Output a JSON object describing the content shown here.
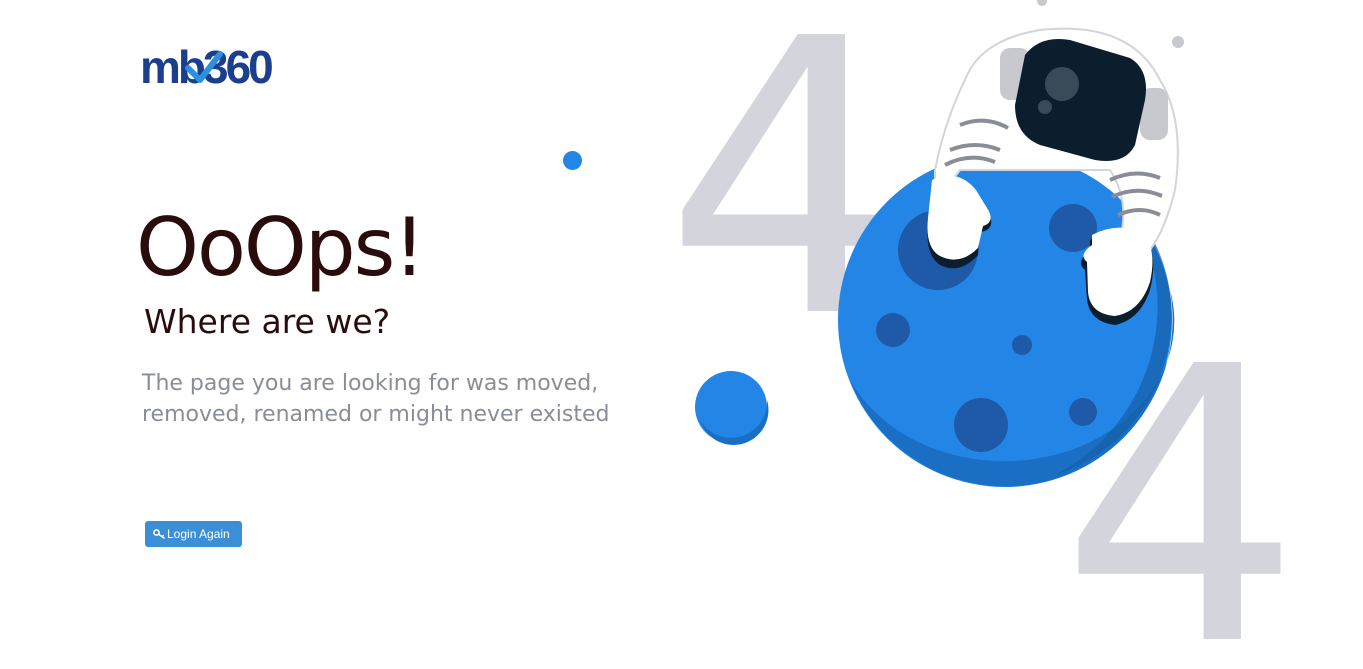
{
  "brand": {
    "logo_text": "mb360",
    "logo_color": "#1b3f8c",
    "check_color": "#2e8fe0"
  },
  "error": {
    "headline": "OoOps!",
    "subheadline": "Where are we?",
    "message": "The page you are looking for was moved, removed, renamed or might never existed",
    "code_digits": [
      "4",
      "4"
    ]
  },
  "actions": {
    "login_label": "Login Again",
    "login_icon": "key-icon",
    "button_color": "#3a8fd6"
  },
  "colors": {
    "heading": "#2a0c0c",
    "body_text": "#8a8d99",
    "planet_blue": "#2386e6",
    "digit_gray": "#d3d4dc"
  }
}
